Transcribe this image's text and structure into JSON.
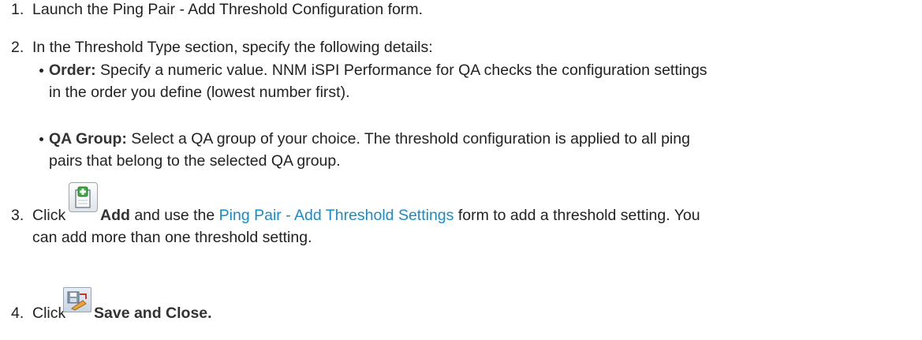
{
  "steps": [
    {
      "number": "1.",
      "text": "Launch the Ping Pair - Add Threshold Configuration form."
    },
    {
      "number": "2.",
      "text": "In the Threshold Type section, specify the following details:",
      "bullets": [
        {
          "label": "Order:",
          "line1": "Specify a numeric value. NNM iSPI Performance for QA checks the configuration settings",
          "line2": "in the order you define (lowest number first)."
        },
        {
          "label": "QA Group:",
          "line1": "Select a QA group of your choice. The threshold configuration is applied to all ping",
          "line2": "pairs that belong to the selected QA group."
        }
      ]
    },
    {
      "number": "3.",
      "click": "Click",
      "action": "Add",
      "mid": "and use the",
      "link": "Ping Pair - Add Threshold Settings",
      "after": "form to add a threshold setting. You",
      "line2": "can add more than one threshold setting.",
      "icon": "add-icon"
    },
    {
      "number": "4.",
      "click": "Click",
      "action": "Save and Close.",
      "icon": "save-and-close-icon"
    }
  ],
  "colors": {
    "text": "#222222",
    "link": "#1a8bc8",
    "icon_green": "#3cab3c"
  }
}
